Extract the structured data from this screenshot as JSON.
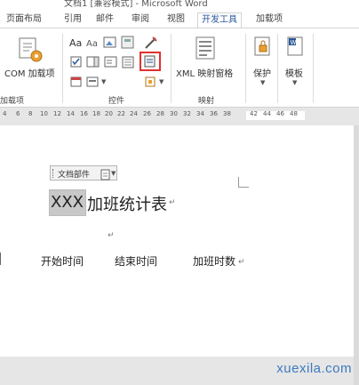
{
  "title_bar": {
    "text": "文档1 [兼容模式] - Microsoft Word"
  },
  "tabs": [
    {
      "label": "页面布局",
      "active": false
    },
    {
      "label": "引用",
      "active": false
    },
    {
      "label": "邮件",
      "active": false
    },
    {
      "label": "审阅",
      "active": false
    },
    {
      "label": "视图",
      "active": false
    },
    {
      "label": "开发工具",
      "active": true
    },
    {
      "label": "加载项",
      "active": false
    }
  ],
  "ribbon": {
    "addins": {
      "com_label": "COM 加载项",
      "group_label": "加载项"
    },
    "controls": {
      "group_label": "控件",
      "selected_control": "building-block-gallery-content-control"
    },
    "mapping": {
      "xml_label": "XML 映射窗格",
      "group_label": "映射"
    },
    "protect": {
      "label": "保护"
    },
    "templates": {
      "label": "模板"
    }
  },
  "ruler": {
    "ticks": [
      "4",
      "6",
      "8",
      "10",
      "12",
      "14",
      "16",
      "18",
      "20",
      "22",
      "24",
      "26",
      "28",
      "30",
      "32",
      "34",
      "36",
      "38",
      "42",
      "44",
      "46",
      "48"
    ]
  },
  "document": {
    "content_control_tag": "文档部件",
    "placeholder_text": "XXX",
    "heading_text": "加班统计表",
    "table_headers": [
      "开始时间",
      "结束时间",
      "加班时数"
    ]
  },
  "colors": {
    "accent": "#2b579a",
    "highlight_box": "#e03030"
  },
  "watermark": "xuexila.com"
}
